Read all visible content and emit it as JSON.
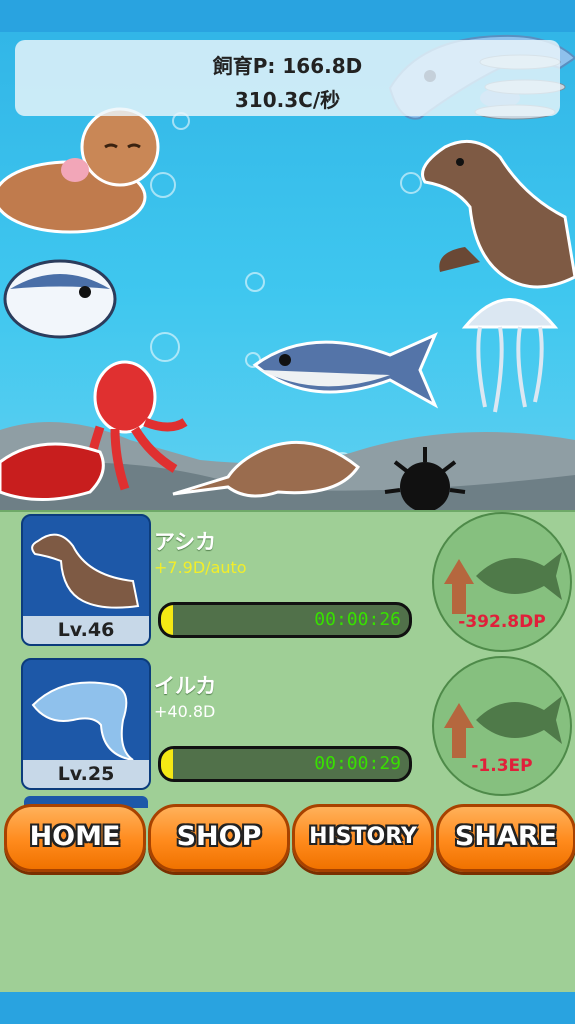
{
  "hud": {
    "points_text": "飼育P: 166.8D",
    "rate_text": "310.3C/秒"
  },
  "creatures": [
    {
      "name": "アシカ",
      "income": "+7.9D/auto",
      "income_color": "#f2ee2a",
      "level": "Lv.46",
      "timer": "00:00:26",
      "progress": 0.05,
      "upgrade_cost": "-392.8DP"
    },
    {
      "name": "イルカ",
      "income": "+40.8D",
      "income_color": "#ffffff",
      "level": "Lv.25",
      "timer": "00:00:29",
      "progress": 0.05,
      "upgrade_cost": "-1.3EP"
    }
  ],
  "nav": {
    "home": "HOME",
    "shop": "SHOP",
    "history": "HISTORY",
    "share": "SHARE"
  },
  "colors": {
    "water": "#3fc7ef",
    "panel": "#9fcf96",
    "button_orange": "#ff8a1c",
    "cost_red": "#e0203a",
    "timer_green": "#38e000"
  }
}
